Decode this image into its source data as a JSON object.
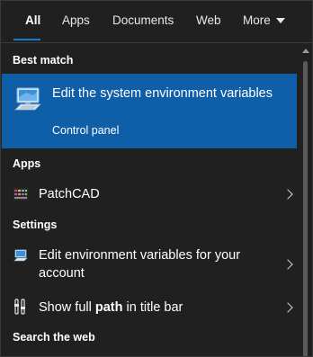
{
  "tabs": [
    {
      "label": "All",
      "active": true
    },
    {
      "label": "Apps"
    },
    {
      "label": "Documents"
    },
    {
      "label": "Web"
    },
    {
      "label": "More"
    }
  ],
  "sections": {
    "best_match": "Best match",
    "apps": "Apps",
    "settings": "Settings",
    "search_web": "Search the web"
  },
  "best_match": {
    "title": "Edit the system environment variables",
    "subtitle": "Control panel",
    "icon": "system-computer-icon"
  },
  "apps": [
    {
      "label": "PatchCAD",
      "icon": "patchcad-icon"
    }
  ],
  "settings": [
    {
      "label": "Edit environment variables for your account",
      "icon": "user-computer-icon"
    },
    {
      "label_pre": "Show full ",
      "label_bold": "path",
      "label_post": " in title bar",
      "icon": "folder-options-icon"
    }
  ],
  "colors": {
    "background": "#202020",
    "selected": "#0f5ea8",
    "accent": "#1976d2"
  }
}
